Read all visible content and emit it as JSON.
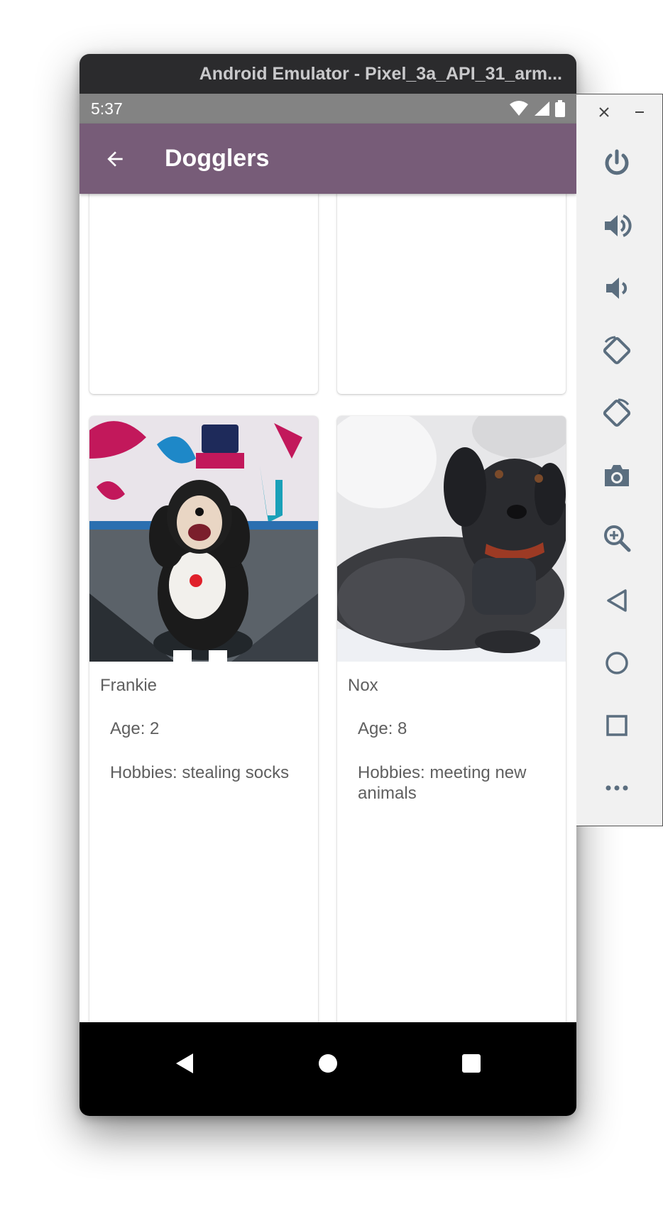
{
  "emulator": {
    "title": "Android Emulator - Pixel_3a_API_31_arm..."
  },
  "statusbar": {
    "time": "5:37"
  },
  "appbar": {
    "title": "Dogglers"
  },
  "dogs": [
    {
      "name": "Frankie",
      "age": "Age: 2",
      "hobbies": "Hobbies: stealing socks"
    },
    {
      "name": "Nox",
      "age": "Age: 8",
      "hobbies": "Hobbies: meeting new animals"
    }
  ],
  "side_controls": [
    "power-icon",
    "volume-up-icon",
    "volume-down-icon",
    "rotate-left-icon",
    "rotate-right-icon",
    "camera-icon",
    "zoom-icon",
    "back-icon",
    "home-icon",
    "overview-icon",
    "more-icon"
  ],
  "colors": {
    "appbar": "#775c78",
    "statusbar": "#838383",
    "controls": "#5b6e7f"
  }
}
